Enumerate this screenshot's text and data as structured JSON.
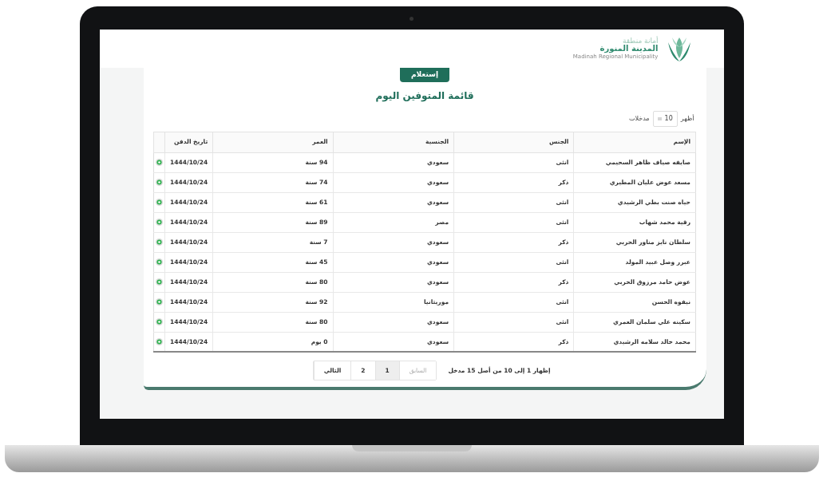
{
  "logo": {
    "line_1": "أمانة منطقة",
    "line_2": "المدينة المنورة",
    "line_3": "Madinah Regional Municipality"
  },
  "query_button": "إستعلام",
  "title": "قائمة المتوفين اليوم",
  "page_size": {
    "label_before": "أظهر",
    "value": "10",
    "label_after": "مدخلات"
  },
  "table": {
    "columns": [
      "الإسم",
      "الجنس",
      "الجنسية",
      "العمر",
      "تاريخ الدفن"
    ],
    "rows": [
      {
        "cells": [
          "صايفه صياف ظاهر السحيمي",
          "انثى",
          "سعودي",
          "94 سنة",
          "1444/10/24"
        ]
      },
      {
        "cells": [
          "مسعد عوض عليان المطيري",
          "ذكر",
          "سعودي",
          "74 سنة",
          "1444/10/24"
        ]
      },
      {
        "cells": [
          "حياه صنت بطي الرشيدي",
          "انثى",
          "سعودي",
          "61 سنة",
          "1444/10/24"
        ]
      },
      {
        "cells": [
          "رقية محمد شهاب",
          "انثى",
          "مصر",
          "89 سنة",
          "1444/10/24"
        ]
      },
      {
        "cells": [
          "سلطان نايز مناور الحربي",
          "ذكر",
          "سعودي",
          "7 سنة",
          "1444/10/24"
        ]
      },
      {
        "cells": [
          "عبرر وصل عبيد المولد",
          "انثى",
          "سعودي",
          "45 سنة",
          "1444/10/24"
        ]
      },
      {
        "cells": [
          "عوض حامد مرزوق الحربي",
          "ذكر",
          "سعودي",
          "80 سنة",
          "1444/10/24"
        ]
      },
      {
        "cells": [
          "نيفوه الحسن",
          "انثى",
          "موريتانيا",
          "92 سنة",
          "1444/10/24"
        ]
      },
      {
        "cells": [
          "سكينه علي سلمان العمري",
          "انثى",
          "سعودي",
          "80 سنة",
          "1444/10/24"
        ]
      },
      {
        "cells": [
          "محمد خالد سلامه الرشيدي",
          "ذكر",
          "سعودي",
          "0 يوم",
          "1444/10/24"
        ]
      }
    ]
  },
  "footer": {
    "info": "إظهار 1 إلى 10 من أصل 15 مدخل",
    "pagination": [
      {
        "label": "السابق",
        "selected": false,
        "disabled": true
      },
      {
        "label": "1",
        "selected": true,
        "disabled": false
      },
      {
        "label": "2",
        "selected": false,
        "disabled": false
      },
      {
        "label": "التالي",
        "selected": false,
        "disabled": false
      }
    ]
  }
}
